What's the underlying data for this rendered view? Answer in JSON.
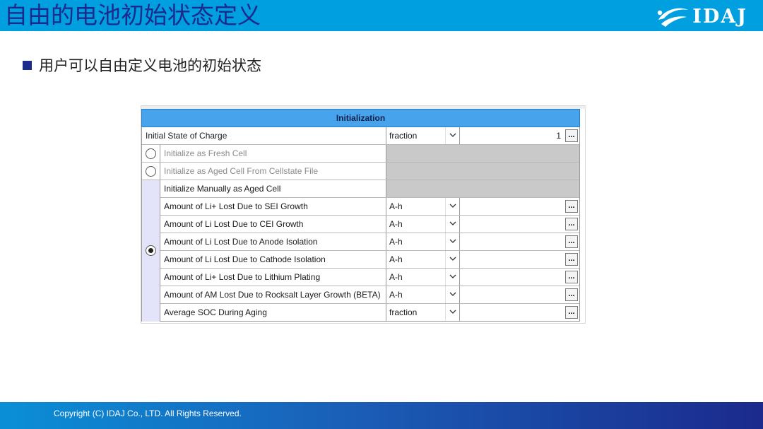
{
  "header": {
    "title": "自由的电池初始状态定义",
    "logo_text": "IDAJ"
  },
  "bullet": {
    "text": "用户可以自由定义电池的初始状态"
  },
  "panel": {
    "section_title": "Initialization",
    "soc_row": {
      "label": "Initial State of Charge",
      "unit": "fraction",
      "value": "1",
      "button": "..."
    },
    "options": [
      {
        "label": "Initialize as Fresh Cell",
        "selected": false
      },
      {
        "label": "Initialize as Aged Cell From Cellstate File",
        "selected": false
      },
      {
        "label": "Initialize Manually as Aged Cell",
        "selected": true
      }
    ],
    "aged_rows": [
      {
        "label": "Amount of Li+ Lost Due to SEI Growth",
        "unit": "A-h",
        "value": "",
        "button": "..."
      },
      {
        "label": "Amount of Li Lost Due to CEI Growth",
        "unit": "A-h",
        "value": "",
        "button": "..."
      },
      {
        "label": "Amount of Li Lost Due to Anode Isolation",
        "unit": "A-h",
        "value": "",
        "button": "..."
      },
      {
        "label": "Amount of Li Lost Due to Cathode Isolation",
        "unit": "A-h",
        "value": "",
        "button": "..."
      },
      {
        "label": "Amount of Li+ Lost Due to Lithium Plating",
        "unit": "A-h",
        "value": "",
        "button": "..."
      },
      {
        "label": "Amount of AM Lost Due to Rocksalt Layer Growth (BETA)",
        "unit": "A-h",
        "value": "",
        "button": "..."
      },
      {
        "label": "Average SOC During Aging",
        "unit": "fraction",
        "value": "",
        "button": "..."
      }
    ]
  },
  "footer": {
    "copyright": "Copyright (C)  IDAJ Co., LTD. All Rights Reserved."
  },
  "colors": {
    "header_bg": "#009fe0",
    "title_color": "#1b2a8c",
    "section_header_bg": "#46a3ec",
    "selected_group_bg": "#e3e3fa"
  }
}
